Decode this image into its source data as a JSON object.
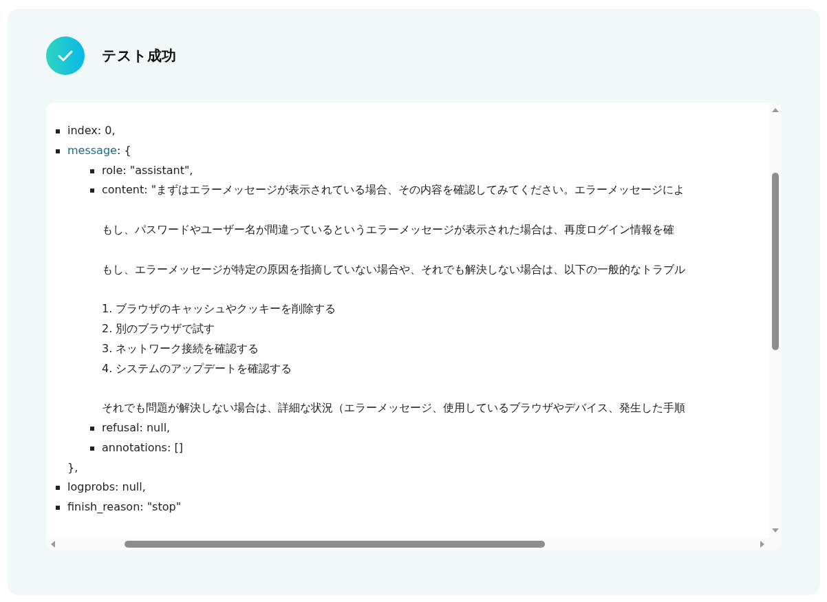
{
  "header": {
    "title": "テスト成功"
  },
  "result": {
    "items": [
      {
        "kind": "field",
        "key": "index",
        "rest": ": 0,"
      },
      {
        "kind": "object",
        "key": "message",
        "rest": ": {",
        "closing": "},",
        "children": [
          {
            "kind": "field",
            "key": "role",
            "rest": ": \"assistant\","
          },
          {
            "kind": "field",
            "key": "content",
            "rest": ": \"まずはエラーメッセージが表示されている場合、その内容を確認してみてください。エラーメッセージによ",
            "paragraphs": [
              [
                "もし、パスワードやユーザー名が間違っているというエラーメッセージが表示された場合は、再度ログイン情報を確"
              ],
              [
                "もし、エラーメッセージが特定の原因を指摘していない場合や、それでも解決しない場合は、以下の一般的なトラブル"
              ],
              [
                "1. ブラウザのキャッシュやクッキーを削除する",
                "2. 別のブラウザで試す",
                "3. ネットワーク接続を確認する",
                "4. システムのアップデートを確認する"
              ],
              [
                "それでも問題が解決しない場合は、詳細な状況（エラーメッセージ、使用しているブラウザやデバイス、発生した手順"
              ]
            ]
          },
          {
            "kind": "field",
            "key": "refusal",
            "rest": ": null,"
          },
          {
            "kind": "field",
            "key": "annotations",
            "rest": ": []"
          }
        ]
      },
      {
        "kind": "field",
        "key": "logprobs",
        "rest": ": null,"
      },
      {
        "kind": "field",
        "key": "finish_reason",
        "rest": ": \"stop\""
      }
    ]
  }
}
